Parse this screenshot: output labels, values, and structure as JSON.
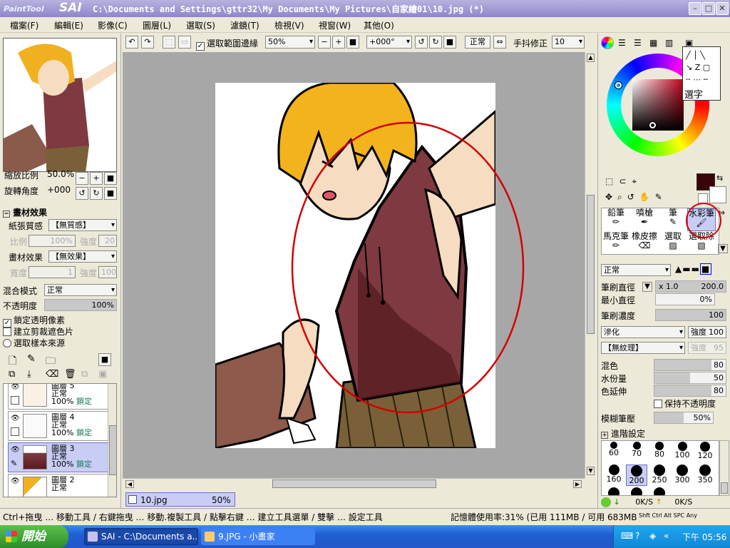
{
  "window": {
    "logo_small": "PaintTool",
    "logo_big": "SAI",
    "title": "C:\\Documents and Settings\\gttr32\\My Documents\\My Pictures\\自家繪01\\10.jpg (*)"
  },
  "menu": [
    "檔案(F)",
    "編輯(E)",
    "影像(C)",
    "圖層(L)",
    "選取(S)",
    "濾鏡(T)",
    "檢視(V)",
    "視窗(W)",
    "其他(O)"
  ],
  "toolbar": {
    "selection_edge_label": "選取範圍邊緣",
    "zoom": "50%",
    "rotation": "+000°",
    "blend": "正常",
    "stabilizer_label": "手抖修正",
    "stabilizer_value": "10"
  },
  "navigator": {
    "zoom_label": "縮放比例",
    "zoom_value": "50.0%",
    "rotate_label": "旋轉角度",
    "rotate_value": "+000"
  },
  "paper": {
    "section": "畫材效果",
    "texture_label": "紙張質感",
    "texture_value": "【無質感】",
    "ratio_label": "比例",
    "ratio_value": "100%",
    "strength_label": "強度",
    "strength_value": "20",
    "effect_label": "畫材效果",
    "effect_value": "【無效果】",
    "width_label": "寬度",
    "width_value": "1",
    "strength2_value": "100"
  },
  "layer_props": {
    "blend_label": "混合模式",
    "blend_value": "正常",
    "opacity_label": "不透明度",
    "opacity_value": "100%",
    "opacity_fill": 1.0,
    "lock_alpha": "鎖定透明像素",
    "clipping": "建立剪裁遮色片",
    "sample_source": "選取樣本來源"
  },
  "layers": [
    {
      "name": "圖層  5",
      "mode": "正常",
      "opacity": "100%",
      "lock": "鎖定",
      "selected": false
    },
    {
      "name": "圖層  4",
      "mode": "正常",
      "opacity": "100%",
      "lock": "鎖定",
      "selected": false
    },
    {
      "name": "圖層  3",
      "mode": "正常",
      "opacity": "100%",
      "lock": "鎖定",
      "selected": true
    },
    {
      "name": "圖層  2",
      "mode": "正常",
      "opacity": "",
      "lock": "",
      "selected": false
    }
  ],
  "document_tab": {
    "name": "10.jpg",
    "zoom": "50%"
  },
  "right": {
    "select_text": "選字",
    "main_color": "#3a0508",
    "tools": [
      "鉛筆",
      "噴槍",
      "筆",
      "水彩筆",
      "馬克筆",
      "橡皮擦",
      "選取",
      "選取除"
    ],
    "selected_tool": "水彩筆",
    "brush_blend": "正常",
    "size_label": "筆刷直徑",
    "size_mult": "x 1.0",
    "size_value": "200.0",
    "min_size_label": "最小直徑",
    "min_size_value": "0%",
    "density_label": "筆刷濃度",
    "density_value": "100",
    "blur_mode": "滲化",
    "blur_strength_label": "強度",
    "blur_strength_value": "100",
    "texture": "【無紋理】",
    "texture_strength_label": "強度",
    "texture_strength_value": "95",
    "blend_label": "混色",
    "blend_value": "80",
    "dilution_label": "水份量",
    "dilution_value": "50",
    "persistence_label": "色延伸",
    "persistence_value": "80",
    "keep_opacity": "保持不透明度",
    "blur_pressure_label": "模糊筆壓",
    "blur_pressure_value": "50%",
    "advanced_label": "進階設定",
    "brush_sizes": [
      "60",
      "70",
      "80",
      "100",
      "120",
      "160",
      "200",
      "250",
      "300",
      "350",
      "",
      "",
      ""
    ],
    "selected_brush_size": "200",
    "speed_down": "0K/S",
    "speed_up": "0K/S"
  },
  "status": {
    "hint": "Ctrl+拖曳 … 移動工具 / 右鍵拖曳 … 移動.複製工具 / 點擊右鍵 … 建立工具選單 / 雙擊 … 設定工具",
    "memory": "記憶體使用率:31% (已用 111MB / 可用 683MB)",
    "mod_keys": "Shft Ctrl Alt SPC Any"
  },
  "taskbar": {
    "start": "開始",
    "tasks": [
      "SAI - C:\\Documents a...",
      "9.JPG - 小畫家"
    ],
    "clock": "下午 05:56"
  },
  "colors": {
    "title_bar": "#8e86c9",
    "selection_highlight": "#c9cdf4",
    "annotation_red": "#d40000"
  }
}
